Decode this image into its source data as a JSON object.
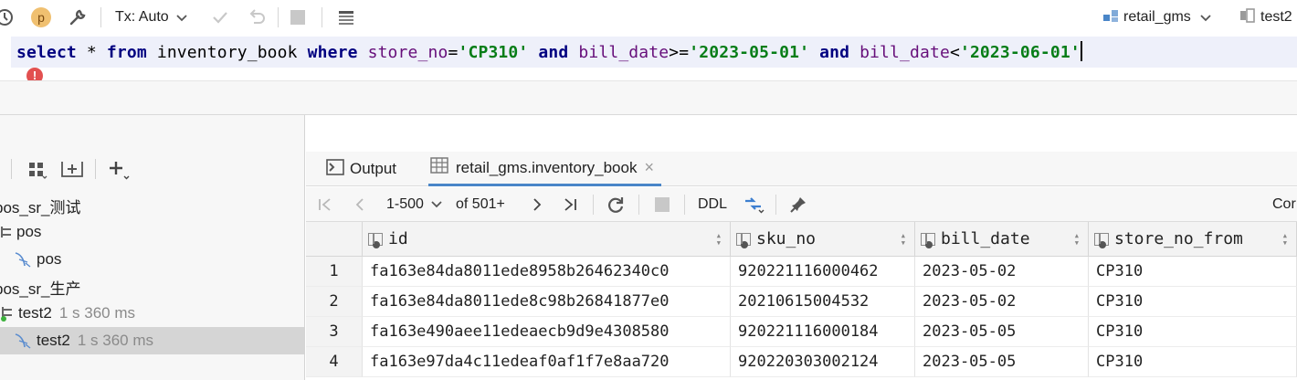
{
  "toolbar": {
    "avatar_letter": "p",
    "tx_label": "Tx: Auto",
    "datasource": "retail_gms",
    "session": "test2"
  },
  "editor": {
    "sql_tokens": [
      {
        "t": "select",
        "c": "kw"
      },
      {
        "t": " * ",
        "c": "id"
      },
      {
        "t": "from",
        "c": "kw"
      },
      {
        "t": " inventory_book ",
        "c": "id"
      },
      {
        "t": "where",
        "c": "kw"
      },
      {
        "t": " ",
        "c": "id"
      },
      {
        "t": "store_no",
        "c": "col"
      },
      {
        "t": "=",
        "c": "id"
      },
      {
        "t": "'CP310'",
        "c": "str"
      },
      {
        "t": " ",
        "c": "id"
      },
      {
        "t": "and",
        "c": "kw"
      },
      {
        "t": " ",
        "c": "id"
      },
      {
        "t": "bill_date",
        "c": "col"
      },
      {
        "t": ">=",
        "c": "id"
      },
      {
        "t": "'2023-05-01'",
        "c": "str"
      },
      {
        "t": " ",
        "c": "id"
      },
      {
        "t": "and",
        "c": "kw"
      },
      {
        "t": " ",
        "c": "id"
      },
      {
        "t": "bill_date",
        "c": "col"
      },
      {
        "t": "<",
        "c": "id"
      },
      {
        "t": "'2023-06-01'",
        "c": "str"
      }
    ],
    "error_glyph": "!"
  },
  "left_panel": {
    "tree": [
      {
        "label": "pos_sr_测试",
        "time": "",
        "indent": 0,
        "icon": "none",
        "selected": false
      },
      {
        "label": "pos",
        "time": "",
        "indent": 1,
        "icon": "schema-icon",
        "selected": false
      },
      {
        "label": "pos",
        "time": "",
        "indent": 2,
        "icon": "console-icon",
        "selected": false
      },
      {
        "label": "pos_sr_生产",
        "time": "",
        "indent": 0,
        "icon": "none",
        "selected": false
      },
      {
        "label": "test2",
        "time": "1 s 360 ms",
        "indent": 1,
        "icon": "schema-active-icon",
        "selected": false
      },
      {
        "label": "test2",
        "time": "1 s 360 ms",
        "indent": 2,
        "icon": "console-icon",
        "selected": true
      }
    ]
  },
  "right_panel": {
    "tabs": [
      {
        "label": "Output",
        "icon": "output-icon"
      },
      {
        "label": "retail_gms.inventory_book",
        "icon": "table-icon",
        "close": "×"
      }
    ],
    "grid_toolbar": {
      "page_range": "1-500",
      "of_label": "of 501+",
      "ddl_label": "DDL",
      "compare_label": "Cor"
    },
    "table": {
      "columns": [
        "id",
        "sku_no",
        "bill_date",
        "store_no_from"
      ],
      "rows": [
        [
          "1",
          "fa163e84da8011ede8958b26462340c0",
          "920221116000462",
          "2023-05-02",
          "CP310"
        ],
        [
          "2",
          "fa163e84da8011ede8c98b26841877e0",
          "20210615004532",
          "2023-05-02",
          "CP310"
        ],
        [
          "3",
          "fa163e490aee11edeaecb9d9e4308580",
          "920221116000184",
          "2023-05-05",
          "CP310"
        ],
        [
          "4",
          "fa163e97da4c11edeaf0af1f7e8aa720",
          "920220303002124",
          "2023-05-05",
          "CP310"
        ]
      ]
    }
  },
  "colors": {
    "keyword": "#000080",
    "column": "#660e7a",
    "string": "#067d17",
    "accent": "#4a86c8",
    "error": "#e25050"
  }
}
